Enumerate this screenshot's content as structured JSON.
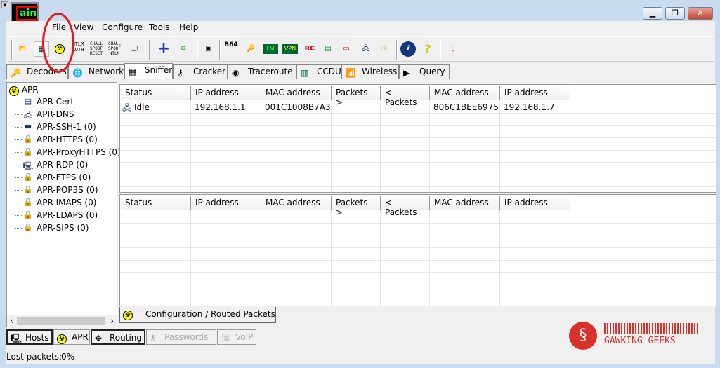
{
  "app": {
    "logo_text": "ain"
  },
  "menu": [
    "File",
    "View",
    "Configure",
    "Tools",
    "Help"
  ],
  "toolbar": {
    "icons": [
      "open-icon",
      "sniffer-start-icon",
      "apr-start-icon",
      "ntlm-auth-icon",
      "chall-spoof-reset-icon",
      "chall-spoof-ntlm-icon",
      "capture-icon",
      "add-icon",
      "recycle-icon",
      "hash-icon",
      "base64-icon",
      "key-icon",
      "lm-icon",
      "vpn-icon",
      "rc-icon",
      "card-icon",
      "monitor-icon",
      "rdp-icon",
      "password-icon",
      "info-icon",
      "help-icon",
      "exit-icon"
    ],
    "labels": {
      "ntlm": "NTLM AUTH",
      "chall_reset": "CHALL SPOOF RESET",
      "chall_ntlm": "CHALL SPOOF NTLM",
      "b64": "B64"
    }
  },
  "tabs": [
    "Decoders",
    "Network",
    "Sniffer",
    "Cracker",
    "Traceroute",
    "CCDU",
    "Wireless",
    "Query"
  ],
  "active_tab": "Sniffer",
  "tree": {
    "root": "APR",
    "items": [
      "APR-Cert",
      "APR-DNS",
      "APR-SSH-1 (0)",
      "APR-HTTPS (0)",
      "APR-ProxyHTTPS (0)",
      "APR-RDP (0)",
      "APR-FTPS (0)",
      "APR-POP3S (0)",
      "APR-IMAPS (0)",
      "APR-LDAPS (0)",
      "APR-SIPS (0)"
    ]
  },
  "columns": [
    "Status",
    "IP address",
    "MAC address",
    "Packets ->",
    "<- Packets",
    "MAC address",
    "IP address"
  ],
  "top_rows": [
    [
      "Idle",
      "192.168.1.1",
      "001C1008B7A3",
      "",
      "",
      "806C1BEE6975",
      "192.168.1.7"
    ]
  ],
  "bottom_rows": [],
  "subtab": "Configuration / Routed Packets",
  "bottom_tabs": [
    {
      "label": "Hosts",
      "enabled": true
    },
    {
      "label": "APR",
      "enabled": true
    },
    {
      "label": "Routing",
      "enabled": true
    },
    {
      "label": "Passwords",
      "enabled": false
    },
    {
      "label": "VoIP",
      "enabled": false
    }
  ],
  "status": {
    "label": "Lost packets:",
    "value": "0%"
  },
  "watermark": "GAWKING GEEKS",
  "colors": {
    "accent_red": "#d9302a",
    "titlebar": "#c9dbee"
  }
}
